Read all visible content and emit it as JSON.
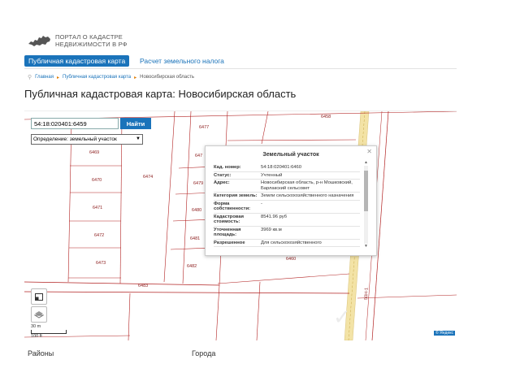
{
  "header": {
    "logo_line1": "ПОРТАЛ О КАДАСТРЕ",
    "logo_line2": "НЕДВИЖИМОСТИ В РФ"
  },
  "nav": {
    "tab_active": "Публичная кадастровая карта",
    "tab_other": "Расчет земельного налога"
  },
  "breadcrumb": {
    "home": "Главная",
    "map": "Публичная кадастровая карта",
    "current": "Новосибирская область"
  },
  "page_title": "Публичная кадастровая карта: Новосибирская область",
  "search": {
    "value": "54:18:020401:6459",
    "button": "Найти"
  },
  "definition": {
    "selected": "Определение: земельный участок"
  },
  "parcels": {
    "p6458": "6458",
    "p6477": "6477",
    "p6469": "6469",
    "p6470": "6470",
    "p6474": "6474",
    "p6471": "6471",
    "p6472": "6472",
    "p6473": "6473",
    "p647x": "647",
    "p6479": "6479",
    "p6480": "6480",
    "p6481": "6481",
    "p6482": "6482",
    "p6483": "6483",
    "p6460": "6460",
    "road": "50Н-1"
  },
  "popup": {
    "title": "Земельный участок",
    "rows": [
      {
        "key": "Кад. номер:",
        "value": "54:18:020401:6460"
      },
      {
        "key": "Статус:",
        "value": "Учтенный"
      },
      {
        "key": "Адрес:",
        "value": "Новосибирская область, р-н Мошковский, Барлакский сельсовет"
      },
      {
        "key": "Категория земель:",
        "value": "Земли сельскохозяйственного назначения"
      },
      {
        "key": "Форма собственности:",
        "value": "-"
      },
      {
        "key": "Кадастровая стоимость:",
        "value": "8541.96 руб"
      },
      {
        "key": "Уточненная площадь:",
        "value": "3969 кв.м"
      },
      {
        "key": "Разрешенное",
        "value": "Для сельскохозяйственного"
      }
    ]
  },
  "scale": {
    "meters": "30 m",
    "feet": "100 ft"
  },
  "attribution": "© Яндекс",
  "footer": {
    "regions": "Районы",
    "cities": "Города"
  },
  "colors": {
    "accent": "#1a73ba",
    "parcel_line": "#b22222",
    "road": "#f3e3a6"
  }
}
